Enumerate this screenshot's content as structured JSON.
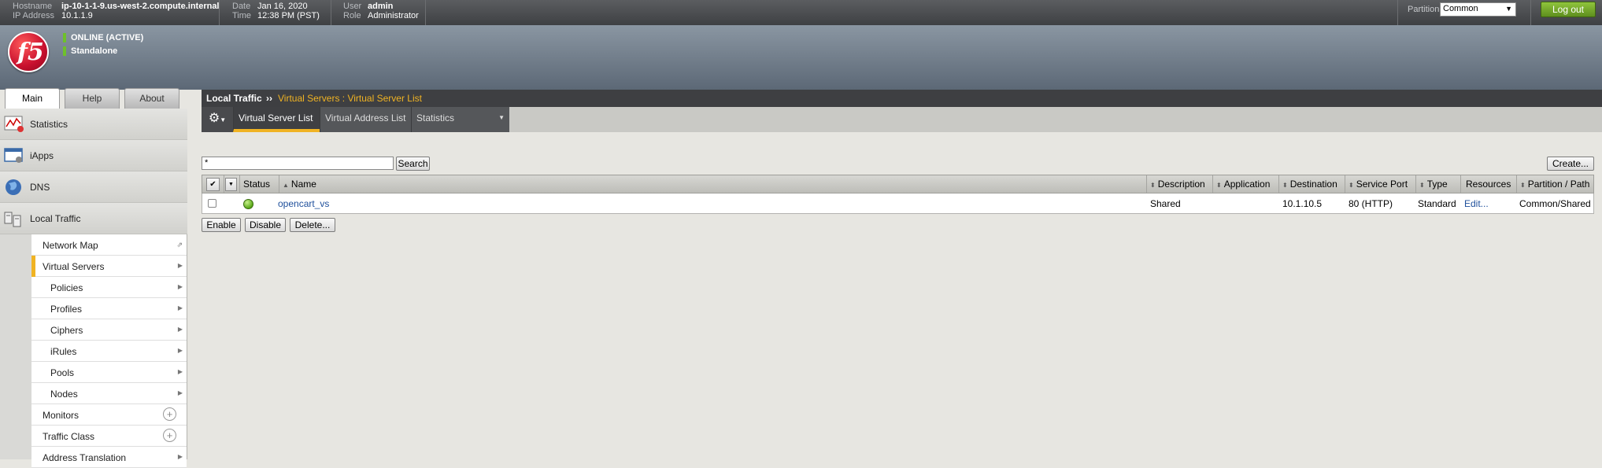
{
  "topbar": {
    "hostname_label": "Hostname",
    "hostname": "ip-10-1-1-9.us-west-2.compute.internal",
    "ip_label": "IP Address",
    "ip": "10.1.1.9",
    "date_label": "Date",
    "date": "Jan 16, 2020",
    "time_label": "Time",
    "time": "12:38 PM (PST)",
    "user_label": "User",
    "user": "admin",
    "role_label": "Role",
    "role": "Administrator",
    "partition_label": "Partition:",
    "partition_value": "Common",
    "logout_label": "Log out"
  },
  "header": {
    "logo_text": "f5",
    "status": "ONLINE (ACTIVE)",
    "mode": "Standalone"
  },
  "left_tabs": [
    "Main",
    "Help",
    "About"
  ],
  "nav": {
    "sections": [
      "Statistics",
      "iApps",
      "DNS",
      "Local Traffic"
    ],
    "local_traffic_items": [
      "Network Map",
      "Virtual Servers",
      "Policies",
      "Profiles",
      "Ciphers",
      "iRules",
      "Pools",
      "Nodes",
      "Monitors",
      "Traffic Class",
      "Address Translation"
    ]
  },
  "breadcrumb": {
    "section": "Local Traffic",
    "separator": "››",
    "page": "Virtual Servers : Virtual Server List"
  },
  "subtabs": [
    "Virtual Server List",
    "Virtual Address List",
    "Statistics"
  ],
  "search": {
    "value": "*",
    "button": "Search",
    "create": "Create..."
  },
  "table": {
    "columns": [
      "Status",
      "Name",
      "Description",
      "Application",
      "Destination",
      "Service Port",
      "Type",
      "Resources",
      "Partition / Path"
    ],
    "rows": [
      {
        "status": "available",
        "name": "opencart_vs",
        "description": "Shared",
        "application": "",
        "destination": "10.1.10.5",
        "service_port": "80 (HTTP)",
        "type": "Standard",
        "resources": "Edit...",
        "partition": "Common/Shared"
      }
    ]
  },
  "actions": [
    "Enable",
    "Disable",
    "Delete..."
  ],
  "colors": {
    "accent": "#f0b323",
    "link": "#1e4f9b",
    "logout": "#6aa52a"
  }
}
